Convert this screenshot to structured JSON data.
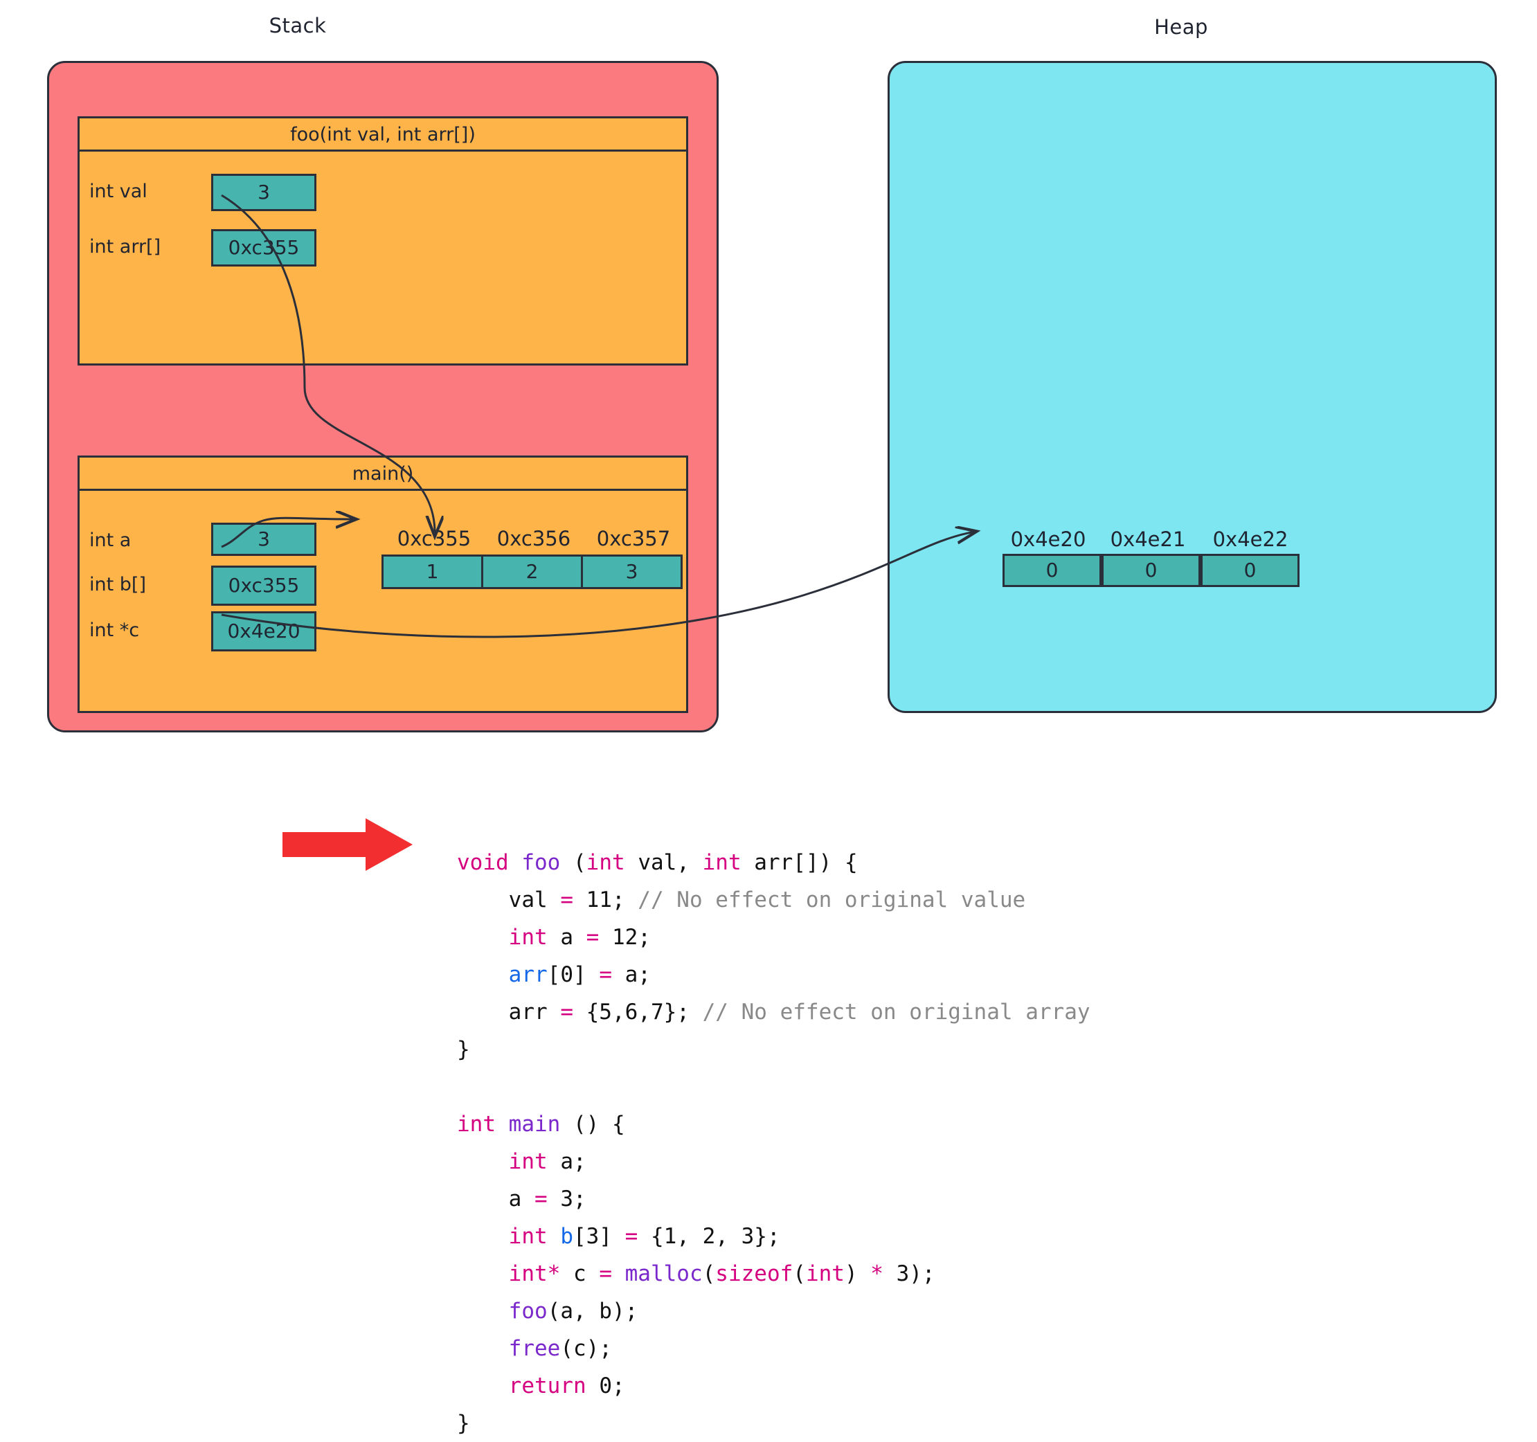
{
  "regions": {
    "stack": {
      "title": "Stack",
      "color": "#FB7A7F"
    },
    "heap": {
      "title": "Heap",
      "color": "#7DE6F0"
    }
  },
  "palette": {
    "stack_bg": "#FB7A7F",
    "heap_bg": "#7DE6F0",
    "frame_bg": "#FFB44A",
    "cell_bg": "#47B5AD",
    "stroke": "#2b2f3a",
    "step_arrow": "#F22E30",
    "keyword": "#D5007F",
    "function": "#7A28CB",
    "identifier": "#1468E8",
    "comment": "#898989"
  },
  "frames": [
    {
      "title": "foo(int val, int arr[])",
      "variables": [
        {
          "label": "int val",
          "value": "3"
        },
        {
          "label": "int arr[]",
          "value": "0xc355"
        }
      ]
    },
    {
      "title": "main()",
      "variables": [
        {
          "label": "int a",
          "value": "3"
        },
        {
          "label": "int b[]",
          "value": "0xc355"
        },
        {
          "label": "int *c",
          "value": "0x4e20"
        }
      ],
      "array": {
        "addresses": [
          "0xc355",
          "0xc356",
          "0xc357"
        ],
        "values": [
          "1",
          "2",
          "3"
        ]
      }
    }
  ],
  "heap_array": {
    "addresses": [
      "0x4e20",
      "0x4e21",
      "0x4e22"
    ],
    "values": [
      "0",
      "0",
      "0"
    ]
  },
  "code": {
    "lines": [
      [
        {
          "t": "void ",
          "c": "kw"
        },
        {
          "t": "foo ",
          "c": "fn"
        },
        {
          "t": "(",
          "c": "plain"
        },
        {
          "t": "int ",
          "c": "kw"
        },
        {
          "t": "val, ",
          "c": "plain"
        },
        {
          "t": "int ",
          "c": "kw"
        },
        {
          "t": "arr[]) {",
          "c": "plain"
        }
      ],
      [
        {
          "t": "    val ",
          "c": "plain"
        },
        {
          "t": "= ",
          "c": "op"
        },
        {
          "t": "11; ",
          "c": "plain"
        },
        {
          "t": "// No effect on original value",
          "c": "cmt"
        }
      ],
      [
        {
          "t": "    ",
          "c": "plain"
        },
        {
          "t": "int ",
          "c": "kw"
        },
        {
          "t": "a ",
          "c": "plain"
        },
        {
          "t": "= ",
          "c": "op"
        },
        {
          "t": "12;",
          "c": "plain"
        }
      ],
      [
        {
          "t": "    ",
          "c": "plain"
        },
        {
          "t": "arr",
          "c": "var"
        },
        {
          "t": "[0] ",
          "c": "plain"
        },
        {
          "t": "= ",
          "c": "op"
        },
        {
          "t": "a;",
          "c": "plain"
        }
      ],
      [
        {
          "t": "    arr ",
          "c": "plain"
        },
        {
          "t": "= ",
          "c": "op"
        },
        {
          "t": "{5,6,7}; ",
          "c": "plain"
        },
        {
          "t": "// No effect on original array",
          "c": "cmt"
        }
      ],
      [
        {
          "t": "}",
          "c": "plain"
        }
      ],
      [
        {
          "t": "",
          "c": "plain"
        }
      ],
      [
        {
          "t": "int ",
          "c": "kw"
        },
        {
          "t": "main ",
          "c": "fn"
        },
        {
          "t": "() {",
          "c": "plain"
        }
      ],
      [
        {
          "t": "    ",
          "c": "plain"
        },
        {
          "t": "int ",
          "c": "kw"
        },
        {
          "t": "a;",
          "c": "plain"
        }
      ],
      [
        {
          "t": "    a ",
          "c": "plain"
        },
        {
          "t": "= ",
          "c": "op"
        },
        {
          "t": "3;",
          "c": "plain"
        }
      ],
      [
        {
          "t": "    ",
          "c": "plain"
        },
        {
          "t": "int ",
          "c": "kw"
        },
        {
          "t": "b",
          "c": "var"
        },
        {
          "t": "[3] ",
          "c": "plain"
        },
        {
          "t": "= ",
          "c": "op"
        },
        {
          "t": "{1, 2, 3};",
          "c": "plain"
        }
      ],
      [
        {
          "t": "    ",
          "c": "plain"
        },
        {
          "t": "int* ",
          "c": "kw"
        },
        {
          "t": "c ",
          "c": "plain"
        },
        {
          "t": "= ",
          "c": "op"
        },
        {
          "t": "malloc",
          "c": "fn"
        },
        {
          "t": "(",
          "c": "plain"
        },
        {
          "t": "sizeof",
          "c": "kw"
        },
        {
          "t": "(",
          "c": "plain"
        },
        {
          "t": "int",
          "c": "kw"
        },
        {
          "t": ") ",
          "c": "plain"
        },
        {
          "t": "* ",
          "c": "op"
        },
        {
          "t": "3);",
          "c": "plain"
        }
      ],
      [
        {
          "t": "    ",
          "c": "plain"
        },
        {
          "t": "foo",
          "c": "fn"
        },
        {
          "t": "(a, b);",
          "c": "plain"
        }
      ],
      [
        {
          "t": "    ",
          "c": "plain"
        },
        {
          "t": "free",
          "c": "fn"
        },
        {
          "t": "(c);",
          "c": "plain"
        }
      ],
      [
        {
          "t": "    ",
          "c": "plain"
        },
        {
          "t": "return ",
          "c": "kw"
        },
        {
          "t": "0;",
          "c": "plain"
        }
      ],
      [
        {
          "t": "}",
          "c": "plain"
        }
      ]
    ]
  }
}
